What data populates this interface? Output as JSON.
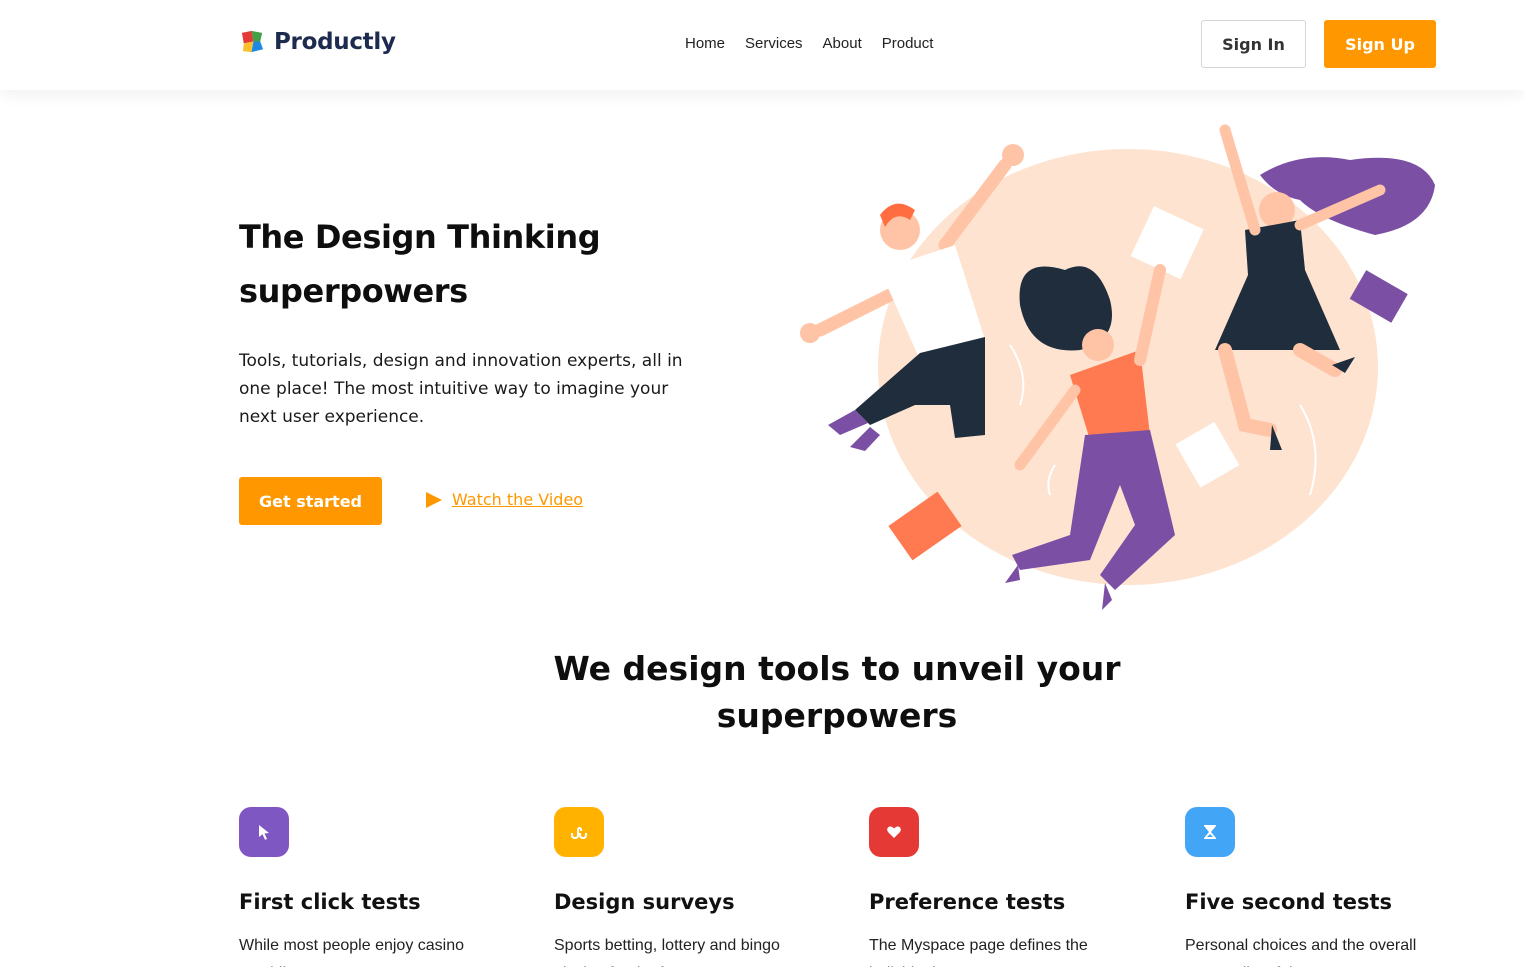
{
  "header": {
    "logo_text": "Productly",
    "nav": [
      "Home",
      "Services",
      "About",
      "Product"
    ],
    "sign_in": "Sign In",
    "sign_up": "Sign Up"
  },
  "hero": {
    "title": "The Design Thinking superpowers",
    "description": "Tools, tutorials, design and innovation experts, all in one place! The most intuitive way to imagine your next user experience.",
    "cta": "Get started",
    "video_link": "Watch the Video"
  },
  "section": {
    "title": "We design tools to unveil your superpowers"
  },
  "features": [
    {
      "title": "First click tests",
      "desc": "While most people enjoy casino gambling,",
      "icon": "cursor-icon",
      "color": "#7e57c2"
    },
    {
      "title": "Design surveys",
      "desc": "Sports betting, lottery and bingo playing for the fun",
      "icon": "stumble-icon",
      "color": "#ffb300"
    },
    {
      "title": "Preference tests",
      "desc": "The Myspace page defines the individual.",
      "icon": "heart-icon",
      "color": "#e53935"
    },
    {
      "title": "Five second tests",
      "desc": "Personal choices and the overall personality of the",
      "icon": "hourglass-icon",
      "color": "#42a5f5"
    }
  ],
  "colors": {
    "accent": "#ff9800",
    "dark": "#1d2b4f"
  }
}
